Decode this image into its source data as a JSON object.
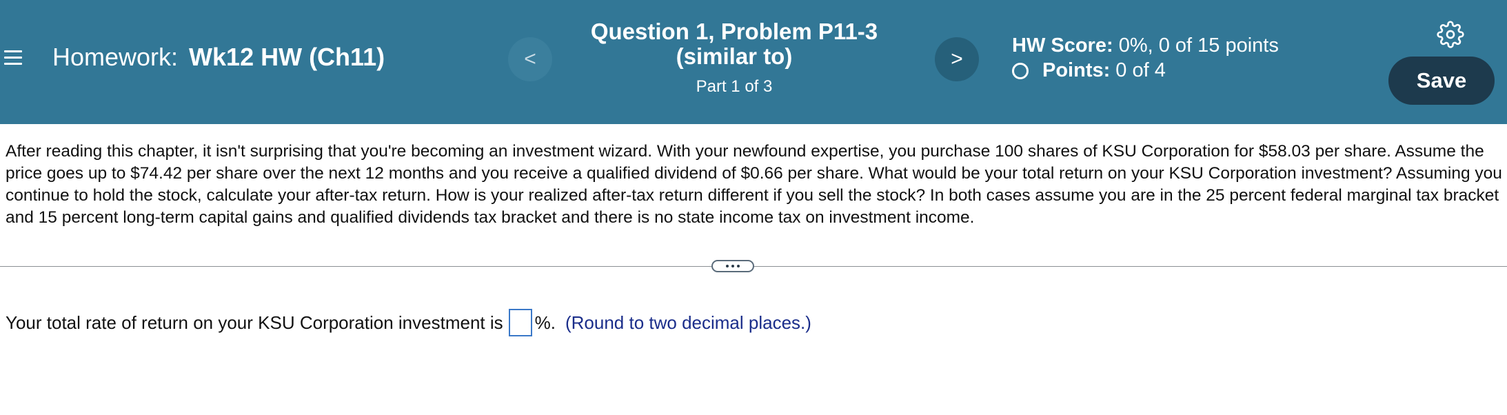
{
  "header": {
    "homework_label": "Homework:",
    "homework_name": "Wk12 HW (Ch11)",
    "prev_icon": "<",
    "next_icon": ">",
    "question_line1": "Question 1, Problem P11-3",
    "question_line2": "(similar to)",
    "part": "Part 1 of 3",
    "hw_score_label": "HW Score:",
    "hw_score_value": "0%, 0 of 15 points",
    "points_label": "Points:",
    "points_value": "0 of 4",
    "save_label": "Save",
    "colors": {
      "header_bg": "#327796",
      "save_bg": "#1d3a4d"
    }
  },
  "problem": {
    "text": "After reading this chapter, it isn't surprising that you're becoming an investment wizard. With your newfound expertise, you purchase 100 shares of KSU Corporation for $58.03 per share. Assume the price goes up to $74.42 per share over the next 12 months and you receive a qualified dividend of $0.66 per share. What would be your total return on your KSU Corporation investment? Assuming you continue to hold the stock, calculate your after-tax return. How is your realized after-tax return different if you sell the stock? In both cases assume you are in the 25 percent federal marginal tax bracket and 15 percent long-term capital gains and qualified dividends tax bracket and there is no state income tax on investment income."
  },
  "answer": {
    "prefix": "Your total rate of return on your KSU Corporation investment is",
    "input_value": "",
    "suffix": "%.",
    "hint": "(Round to two decimal places.)"
  },
  "icons": {
    "menu": "menu-icon",
    "gear": "gear-icon",
    "expand": "more-dots-icon",
    "radio": "circle-icon"
  }
}
